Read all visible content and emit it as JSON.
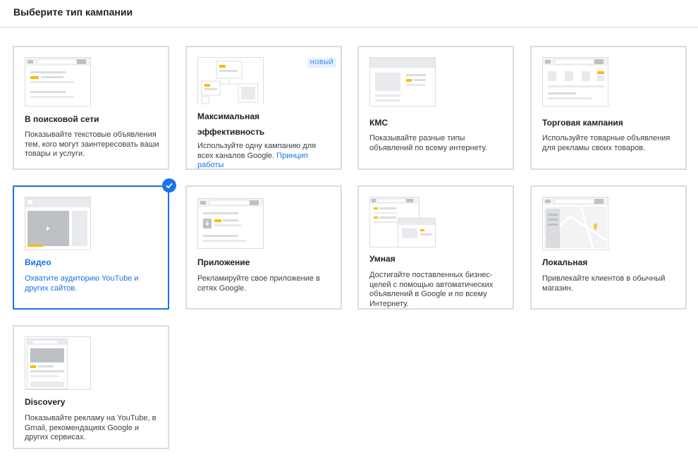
{
  "header": {
    "title": "Выберите тип кампании"
  },
  "cards": [
    {
      "title": "В поисковой сети",
      "description": "Показывайте текстовые объявления тем, кого могут заинтересовать ваши товары и услуги."
    },
    {
      "title": "Максимальная эффективность",
      "badge": "НОВЫЙ",
      "description": "Используйте одну кампанию для всех каналов Google.",
      "link": "Принцип работы"
    },
    {
      "title": "КМС",
      "description": "Показывайте разные типы объявлений по всему интернету."
    },
    {
      "title": "Торговая кампания",
      "description": "Используйте товарные объявления для рекламы своих товаров."
    },
    {
      "title": "Видео",
      "description": "Охватите аудиторию YouTube и других сайтов.",
      "selected": true
    },
    {
      "title": "Приложение",
      "description": "Рекламируйте свое приложение в сетях Google."
    },
    {
      "title": "Умная",
      "description": "Достигайте поставленных бизнес-целей с помощью автоматических объявлений в Google и по всему Интернету."
    },
    {
      "title": "Локальная",
      "description": "Привлекайте клиентов в обычный магазин."
    },
    {
      "title": "Discovery",
      "description": "Показывайте рекламу на YouTube, в Gmail, рекомендациях Google и других сервисах."
    }
  ],
  "colors": {
    "accent": "#1a73e8",
    "highlight": "#fbbc04",
    "border": "#dadce0"
  }
}
